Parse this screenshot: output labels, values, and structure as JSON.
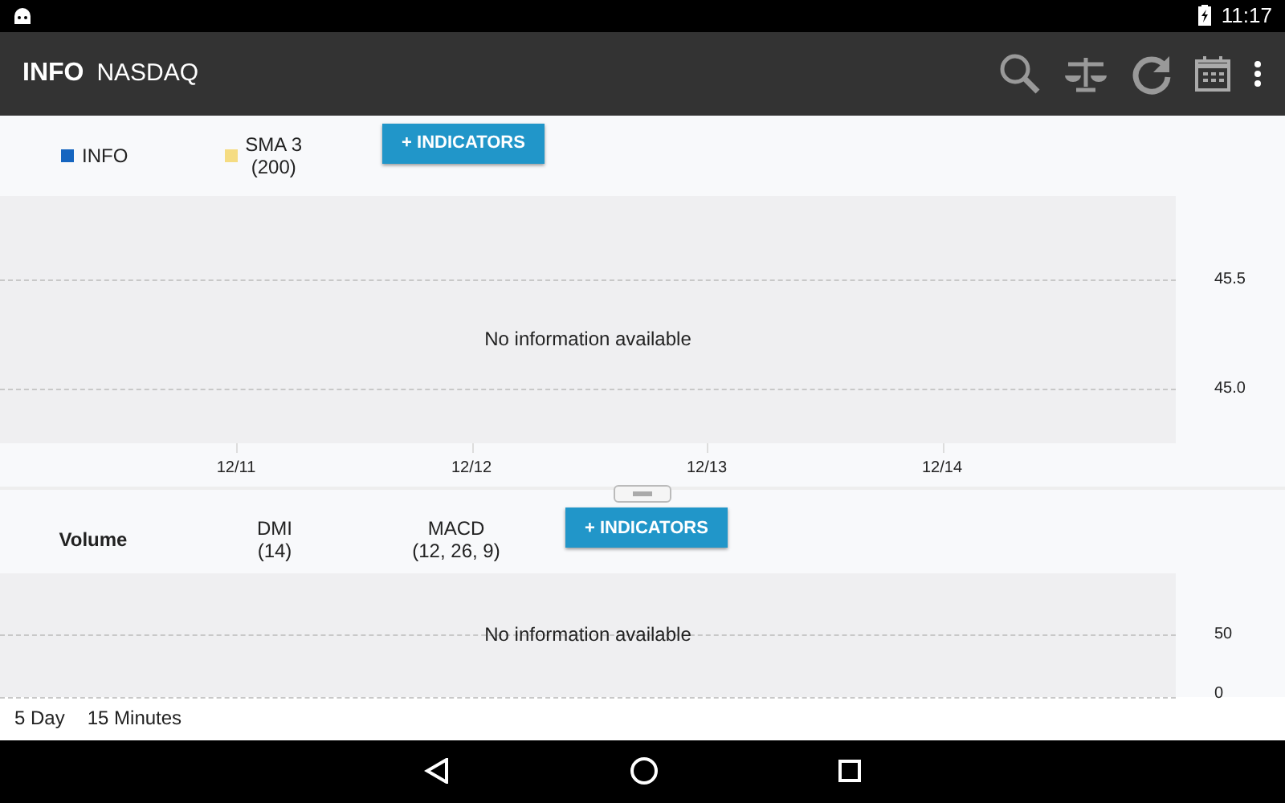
{
  "status_bar": {
    "time": "11:17"
  },
  "app_bar": {
    "title": "INFO",
    "subtitle": "NASDAQ"
  },
  "price_panel": {
    "legend": [
      {
        "label": "INFO",
        "color": "#1565c0"
      },
      {
        "label": "SMA 3\n(200)",
        "color": "#f5dc82"
      }
    ],
    "button": "+ INDICATORS",
    "message": "No information available",
    "y_labels": [
      "45.5",
      "45.0"
    ],
    "x_labels": [
      "12/11",
      "12/12",
      "12/13",
      "12/14"
    ]
  },
  "lower_panel": {
    "tabs": [
      {
        "label": "Volume",
        "selected": true
      },
      {
        "label": "DMI\n(14)",
        "selected": false
      },
      {
        "label": "MACD\n(12, 26, 9)",
        "selected": false
      }
    ],
    "button": "+ INDICATORS",
    "message": "No information available",
    "y_labels": [
      "50",
      "0"
    ]
  },
  "footer": {
    "range": "5 Day",
    "interval": "15 Minutes"
  }
}
